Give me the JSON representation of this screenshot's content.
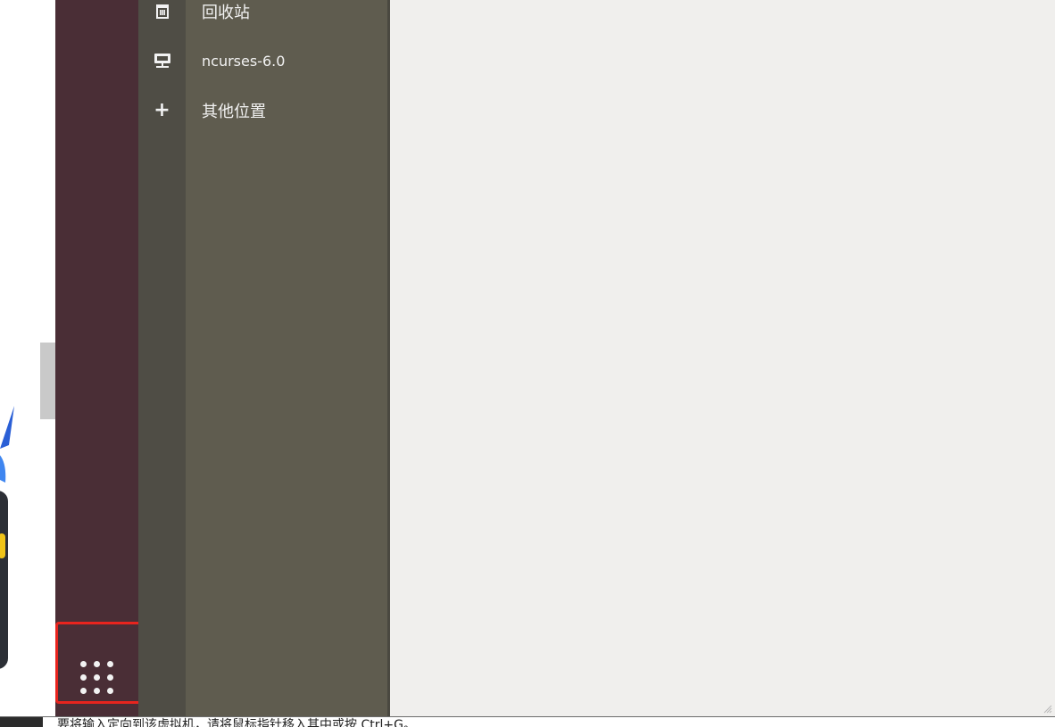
{
  "sidebar": {
    "items": [
      {
        "label": "回收站",
        "icon": "trash-icon"
      },
      {
        "label": "ncurses-6.0",
        "icon": "network-drive-icon"
      },
      {
        "label": "其他位置",
        "icon": "plus-icon"
      }
    ]
  },
  "launcher": {
    "apps_button_icon": "show-applications-icon"
  },
  "statusbar": {
    "hint_text": "要将输入定向到该虚拟机，请将鼠标指针移入其中或按 Ctrl+G。"
  },
  "colors": {
    "launcher_bg": "#4a2e36",
    "sidebar_bg": "#5f5c4f",
    "sidebar_icon_col_bg": "#4f4d45",
    "content_bg": "#f0efed",
    "highlight_border": "#e8241e"
  }
}
